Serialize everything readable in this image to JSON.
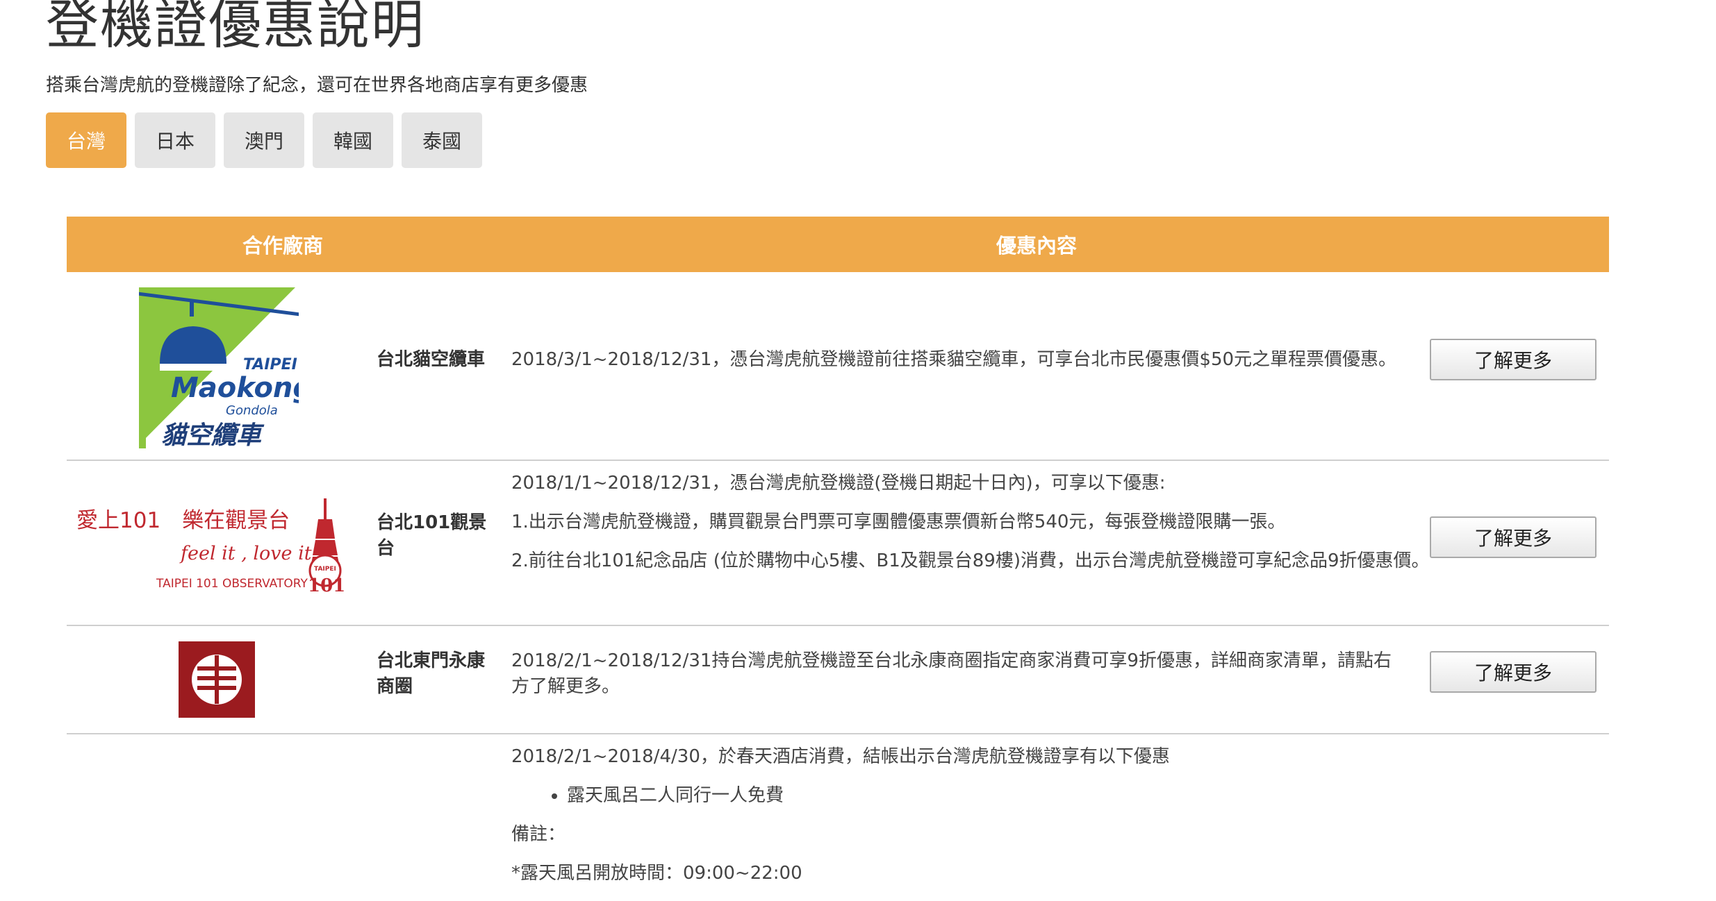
{
  "header": {
    "title": "登機證優惠說明",
    "subtitle": "搭乘台灣虎航的登機證除了紀念，還可在世界各地商店享有更多優惠"
  },
  "tabs": [
    {
      "label": "台灣",
      "active": true
    },
    {
      "label": "日本",
      "active": false
    },
    {
      "label": "澳門",
      "active": false
    },
    {
      "label": "韓國",
      "active": false
    },
    {
      "label": "泰國",
      "active": false
    }
  ],
  "table": {
    "headers": {
      "partner": "合作廠商",
      "offer": "優惠內容"
    },
    "more_label": "了解更多",
    "rows": [
      {
        "name": "台北貓空纜車",
        "logo": {
          "top": "TAIPEI",
          "main": "Maokong",
          "sub": "Gondola",
          "chinese": "貓空纜車"
        },
        "desc": [
          "2018/3/1~2018/12/31，憑台灣虎航登機證前往搭乘貓空纜車，可享台北市民優惠價$50元之單程票價優惠。"
        ]
      },
      {
        "name": "台北101觀景台",
        "logo": {
          "line1": "愛上101　樂在觀景台",
          "line2": "feel it , love it !",
          "line3": "TAIPEI 101 OBSERVATORY",
          "badge_top": "TAIPEI",
          "badge_num": "101"
        },
        "desc": [
          "2018/1/1~2018/12/31，憑台灣虎航登機證(登機日期起十日內)，可享以下優惠:",
          "1.出示台灣虎航登機證，購買觀景台門票可享團體優惠票價新台幣540元，每張登機證限購一張。",
          "2.前往台北101紀念品店 (位於購物中心5樓、B1及觀景台89樓)消費，出示台灣虎航登機證可享紀念品9折優惠價。"
        ]
      },
      {
        "name": "台北東門永康商圈",
        "desc": [
          "2018/2/1~2018/12/31持台灣虎航登機證至台北永康商圈指定商家消費可享9折優惠，詳細商家清單，請點右方了解更多。"
        ]
      },
      {
        "intro": "2018/2/1~2018/4/30，於春天酒店消費，結帳出示台灣虎航登機證享有以下優惠",
        "bullet": "露天風呂二人同行一人免費",
        "note_label": "備註：",
        "note": "*露天風呂開放時間：09:00~22:00"
      }
    ]
  },
  "colors": {
    "accent": "#efa94a",
    "maokong_green": "#8cc63f",
    "maokong_blue": "#1f4f9a",
    "taipei101_red": "#c0282f",
    "yongkang_red": "#9b1b1f"
  }
}
